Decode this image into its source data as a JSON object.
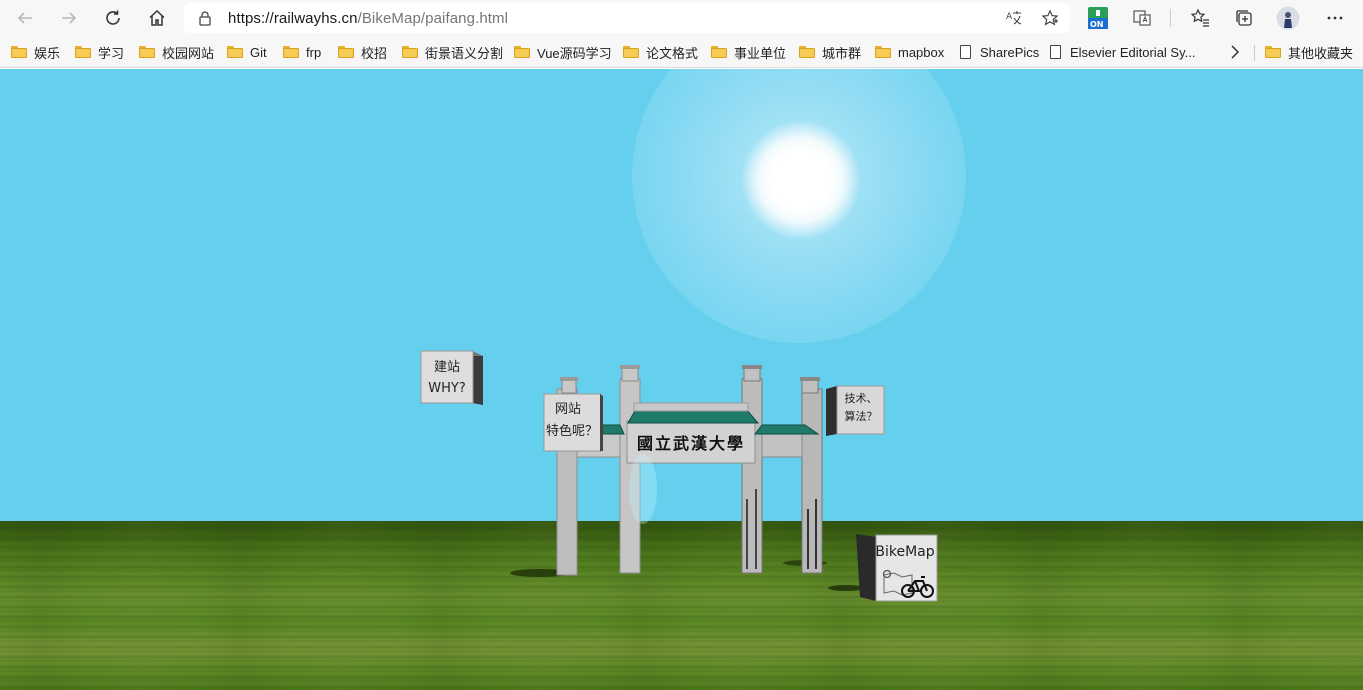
{
  "browser": {
    "url_host": "https://railwayhs.cn",
    "url_path": "/BikeMap/paifang.html",
    "ext_badge": "ON"
  },
  "bookmarks": [
    {
      "label": "娱乐",
      "type": "folder"
    },
    {
      "label": "学习",
      "type": "folder"
    },
    {
      "label": "校园网站",
      "type": "folder"
    },
    {
      "label": "Git",
      "type": "folder"
    },
    {
      "label": "frp",
      "type": "folder"
    },
    {
      "label": "校招",
      "type": "folder"
    },
    {
      "label": "街景语义分割",
      "type": "folder"
    },
    {
      "label": "Vue源码学习",
      "type": "folder"
    },
    {
      "label": "论文格式",
      "type": "folder"
    },
    {
      "label": "事业单位",
      "type": "folder"
    },
    {
      "label": "城市群",
      "type": "folder"
    },
    {
      "label": "mapbox",
      "type": "folder"
    },
    {
      "label": "SharePics",
      "type": "page"
    },
    {
      "label": "Elsevier Editorial Sy...",
      "type": "page"
    }
  ],
  "other_bookmarks": "其他收藏夹",
  "scene": {
    "gate_plaque": "國立武漢大學",
    "box_why": {
      "line1": "建站",
      "line2": "WHY?"
    },
    "box_feature": {
      "line1": "网站",
      "line2": "特色呢？"
    },
    "box_tech": {
      "line1": "技术、",
      "line2": "算法？"
    },
    "box_bikemap": "BikeMap"
  }
}
